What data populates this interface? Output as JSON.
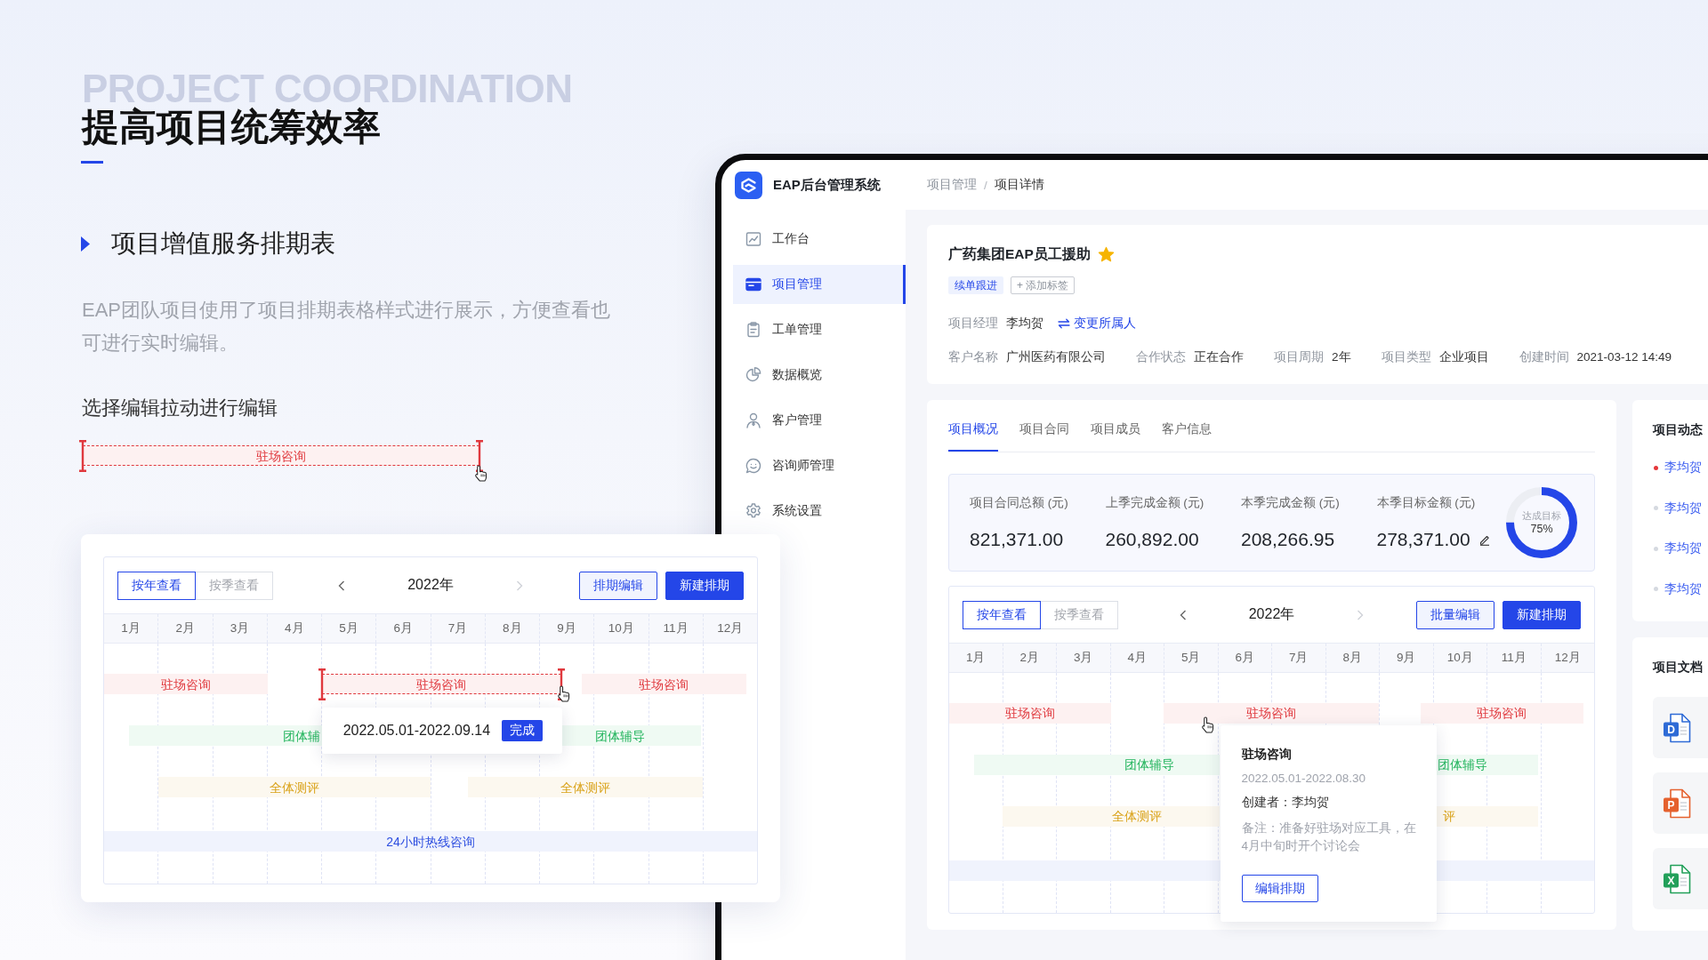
{
  "intro": {
    "background_title": "PROJECT COORDINATION",
    "title": "提高项目统筹效率"
  },
  "feature": {
    "title": "项目增值服务排期表",
    "description": "EAP团队项目使用了项目排期表格样式进行展示，方便查看也可进行实时编辑。",
    "hint": "选择编辑拉动进行编辑",
    "demo_bar": {
      "label": "驻场咨询",
      "color": "#e0393e",
      "selected": true
    }
  },
  "schedule_card": {
    "view_tabs": [
      {
        "label": "按年查看",
        "selected": true
      },
      {
        "label": "按季查看",
        "selected": false
      }
    ],
    "prev_disabled": false,
    "year": "2022年",
    "next_disabled": true,
    "buttons": [
      {
        "label": "排期编辑",
        "kind": "outline"
      },
      {
        "label": "新建排期",
        "kind": "primary"
      }
    ],
    "months": [
      "1月",
      "2月",
      "3月",
      "4月",
      "5月",
      "6月",
      "7月",
      "8月",
      "9月",
      "10月",
      "11月",
      "12月"
    ],
    "rows": [
      {
        "color": "#e0393e",
        "bars": [
          {
            "label": "驻场咨询",
            "selected": false
          },
          {
            "label": "驻场咨询",
            "selected": true
          },
          {
            "label": "驻场咨询",
            "selected": false
          }
        ]
      },
      {
        "color": "#1fb35a",
        "bars": [
          {
            "label": "团体辅",
            "selected": false
          },
          {
            "label": "团体辅导",
            "selected": false
          }
        ]
      },
      {
        "color": "#d9a116",
        "bars": [
          {
            "label": "全体测评",
            "selected": false
          },
          {
            "label": "全体测评",
            "selected": false
          }
        ]
      },
      {
        "color": "#2e4fe0",
        "bars": [
          {
            "label": "24小时热线咨询",
            "selected": false
          }
        ]
      }
    ],
    "popover": {
      "kind": "compact",
      "range": "2022.05.01-2022.09.14",
      "badge": "完成"
    }
  },
  "app": {
    "brand": "EAP后台管理系统",
    "breadcrumb": {
      "items": [
        "项目管理",
        "项目详情"
      ],
      "separator": "/"
    },
    "sidebar": [
      {
        "label": "工作台",
        "selected": false
      },
      {
        "label": "项目管理",
        "selected": true
      },
      {
        "label": "工单管理",
        "selected": false
      },
      {
        "label": "数据概览",
        "selected": false
      },
      {
        "label": "客户管理",
        "selected": false
      },
      {
        "label": "咨询师管理",
        "selected": false
      },
      {
        "label": "系统设置",
        "selected": false
      }
    ],
    "project": {
      "name": "广药集团EAP员工援助",
      "starred": true,
      "tags": [
        {
          "label": "续单跟进",
          "kind": "status"
        },
        {
          "label": "+ 添加标签",
          "kind": "add"
        }
      ],
      "manager": {
        "label": "项目经理",
        "value": "李均贺",
        "link": "变更所属人"
      },
      "details": [
        {
          "label": "客户名称",
          "value": "广州医药有限公司"
        },
        {
          "label": "合作状态",
          "value": "正在合作"
        },
        {
          "label": "项目周期",
          "value": "2年"
        },
        {
          "label": "项目类型",
          "value": "企业项目"
        },
        {
          "label": "创建时间",
          "value": "2021-03-12 14:49"
        }
      ]
    },
    "tabs": [
      {
        "label": "项目概况",
        "selected": true
      },
      {
        "label": "项目合同",
        "selected": false
      },
      {
        "label": "项目成员",
        "selected": false
      },
      {
        "label": "客户信息",
        "selected": false
      }
    ],
    "stats": [
      {
        "label": "项目合同总额 (元)",
        "value": "821,371.00",
        "editable": false
      },
      {
        "label": "上季完成金额 (元)",
        "value": "260,892.00",
        "editable": false
      },
      {
        "label": "本季完成金额 (元)",
        "value": "208,266.95",
        "editable": false
      },
      {
        "label": "本季目标金额 (元)",
        "value": "278,371.00",
        "editable": true
      }
    ],
    "goal": {
      "label": "达成目标",
      "reading": "75%",
      "level": 0.75
    },
    "schedule": {
      "view_tabs": [
        {
          "label": "按年查看",
          "selected": true
        },
        {
          "label": "按季查看",
          "selected": false
        }
      ],
      "prev_disabled": false,
      "year": "2022年",
      "next_disabled": true,
      "buttons": [
        {
          "label": "批量编辑",
          "kind": "outline"
        },
        {
          "label": "新建排期",
          "kind": "primary"
        }
      ],
      "months": [
        "1月",
        "2月",
        "3月",
        "4月",
        "5月",
        "6月",
        "7月",
        "8月",
        "9月",
        "10月",
        "11月",
        "12月"
      ],
      "rows": [
        {
          "color": "#e0393e",
          "bars": [
            {
              "label": "驻场咨询",
              "selected": false
            },
            {
              "label": "驻场咨询",
              "selected": false
            },
            {
              "label": "驻场咨询",
              "selected": false
            }
          ]
        },
        {
          "color": "#1fb35a",
          "bars": [
            {
              "label": "团体辅导",
              "selected": false
            },
            {
              "label": "团体辅导",
              "selected": false
            }
          ]
        },
        {
          "color": "#d9a116",
          "bars": [
            {
              "label": "全体测评",
              "selected": false
            },
            {
              "label": "评",
              "selected": false
            }
          ]
        },
        {
          "bars": [
            {
              "selected": false
            }
          ]
        }
      ],
      "popover": {
        "kind": "detail",
        "title": "驻场咨询",
        "range": "2022.05.01-2022.08.30",
        "creator": "创建者：李均贺",
        "note": "备注：准备好驻场对应工具，在4月中旬时开个讨论会",
        "button": "编辑排期"
      }
    },
    "activity": {
      "title": "项目动态",
      "items": [
        {
          "name": "李均贺",
          "color": "#e5383b"
        },
        {
          "name": "李均贺",
          "color": "#d5d9e0"
        },
        {
          "name": "李均贺",
          "color": "#d5d9e0"
        },
        {
          "name": "李均贺",
          "color": "#d5d9e0"
        }
      ]
    },
    "documents": {
      "title": "项目文档",
      "files": [
        {
          "letter": "D",
          "color": "#2f6bd6"
        },
        {
          "letter": "P",
          "color": "#e5612e"
        },
        {
          "letter": "X",
          "color": "#23a05a"
        }
      ]
    }
  }
}
